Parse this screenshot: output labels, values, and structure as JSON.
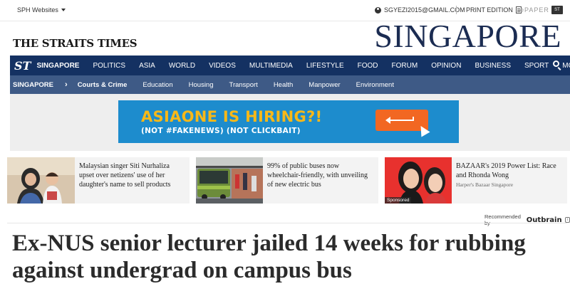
{
  "topbar": {
    "sph_label": "SPH Websites",
    "account_email": "SGYEZI2015@GMAIL.COM",
    "print_edition": "PRINT EDITION",
    "epaper_label": "ePAPER"
  },
  "masthead": {
    "logo": "THE STRAITS TIMES",
    "section": "SINGAPORE"
  },
  "main_nav": {
    "logo": "ST",
    "items": [
      "SINGAPORE",
      "POLITICS",
      "ASIA",
      "WORLD",
      "VIDEOS",
      "MULTIMEDIA",
      "LIFESTYLE",
      "FOOD",
      "FORUM",
      "OPINION",
      "BUSINESS",
      "SPORT"
    ],
    "more": "MORE"
  },
  "sub_nav": {
    "section": "SINGAPORE",
    "items": [
      "Courts & Crime",
      "Education",
      "Housing",
      "Transport",
      "Health",
      "Manpower",
      "Environment"
    ]
  },
  "banner": {
    "headline": "ASIAONE IS HIRING?!",
    "subline": "(NOT #FAKENEWS) (NOT CLICKBAIT)"
  },
  "recommended": {
    "tiles": [
      {
        "headline": "Malaysian singer Siti Nurhaliza upset over netizens' use of her daughter's name to sell products",
        "source": ""
      },
      {
        "headline": "99% of public buses now wheelchair-friendly, with unveiling of new electric bus",
        "source": ""
      },
      {
        "headline": "BAZAAR's 2019 Power List: Race and Rhonda Wong",
        "source": "Harper's Bazaar Singapore",
        "badge": "Sponsored"
      }
    ],
    "label": "Recommended by",
    "brand": "Outbrain"
  },
  "article": {
    "title": "Ex-NUS senior lecturer jailed 14 weeks for rubbing against undergrad on campus bus"
  },
  "colors": {
    "nav_bg": "#143162",
    "subnav_bg": "#3e5a86",
    "banner_bg": "#1d8ccd",
    "banner_headline": "#f8b818",
    "banner_button": "#f26722"
  }
}
